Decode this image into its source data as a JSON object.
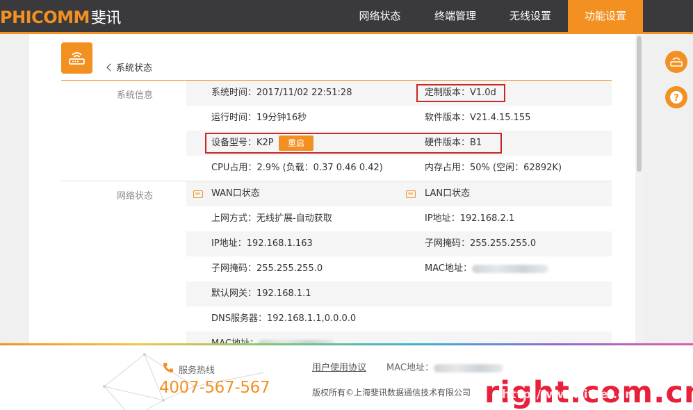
{
  "brand": {
    "logo_latin": "PHICOMM",
    "logo_cn": "斐讯"
  },
  "nav": [
    {
      "label": "网络状态"
    },
    {
      "label": "终端管理"
    },
    {
      "label": "无线设置"
    },
    {
      "label": "功能设置",
      "active": true
    }
  ],
  "page": {
    "back_label": "系统状态"
  },
  "system_info": {
    "section_label": "系统信息",
    "system_time_label": "系统时间：",
    "system_time_value": "2017/11/02 22:51:28",
    "custom_version_label": "定制版本：",
    "custom_version_value": "V1.0d",
    "uptime_label": "运行时间：",
    "uptime_value": "19分钟16秒",
    "software_version_label": "软件版本：",
    "software_version_value": "V21.4.15.155",
    "device_model_label": "设备型号：",
    "device_model_value": "K2P",
    "restart_label": "重启",
    "hardware_version_label": "硬件版本：",
    "hardware_version_value": "B1",
    "cpu_label": "CPU占用：",
    "cpu_value": "2.9% (负载：0.37 0.46 0.42)",
    "memory_label": "内存占用：",
    "memory_value": "50% (空闲：62892K)"
  },
  "network_status": {
    "section_label": "网络状态",
    "wan": {
      "title": "WAN口状态",
      "connection_label": "上网方式：",
      "connection_value": "无线扩展-自动获取",
      "ip_label": "IP地址：",
      "ip_value": "192.168.1.163",
      "mask_label": "子网掩码：",
      "mask_value": "255.255.255.0",
      "gateway_label": "默认网关：",
      "gateway_value": "192.168.1.1",
      "dns_label": "DNS服务器：",
      "dns_value": "192.168.1.1,0.0.0.0",
      "mac_label": "MAC地址："
    },
    "lan": {
      "title": "LAN口状态",
      "ip_label": "IP地址：",
      "ip_value": "192.168.2.1",
      "mask_label": "子网掩码：",
      "mask_value": "255.255.255.0",
      "mac_label": "MAC地址："
    }
  },
  "footer": {
    "hotline_label": "服务热线",
    "hotline_number": "4007-567-567",
    "user_agreement": "用户使用协议",
    "mac_label": "MAC地址：",
    "copyright": "版权所有©上海斐讯数据通信技术有限公司"
  },
  "watermark": {
    "text": "right.com.cn",
    "url": "http://www.ittel.cn"
  },
  "colors": {
    "accent": "#f39022",
    "topbar": "#3a3a3c",
    "highlight_box": "#c62828"
  }
}
